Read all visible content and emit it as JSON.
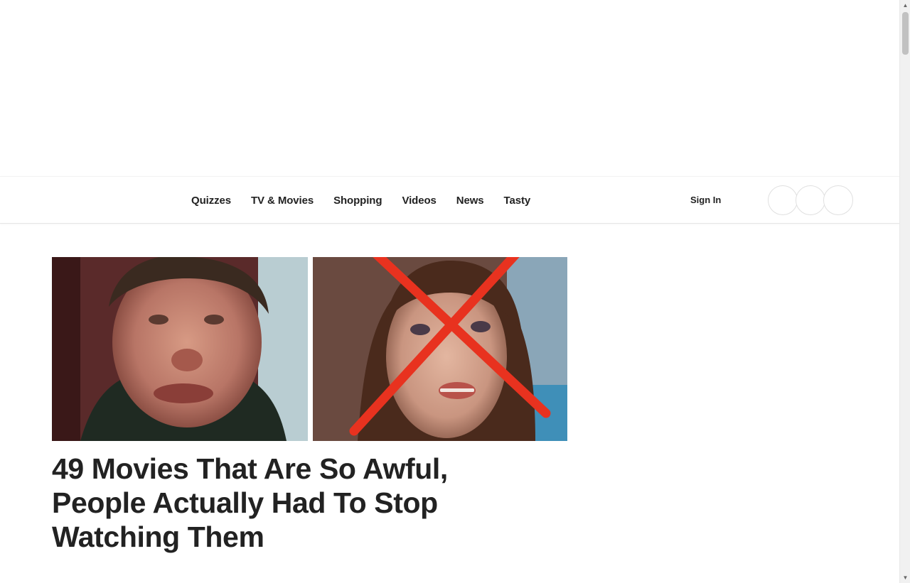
{
  "nav": {
    "items": [
      {
        "label": "Quizzes"
      },
      {
        "label": "TV & Movies"
      },
      {
        "label": "Shopping"
      },
      {
        "label": "Videos"
      },
      {
        "label": "News"
      },
      {
        "label": "Tasty"
      }
    ],
    "sign_in": "Sign In"
  },
  "article": {
    "headline": "49 Movies That Are So Awful, People Actually Had To Stop Watching Them"
  },
  "colors": {
    "text": "#222222",
    "cross": "#e8321f"
  }
}
